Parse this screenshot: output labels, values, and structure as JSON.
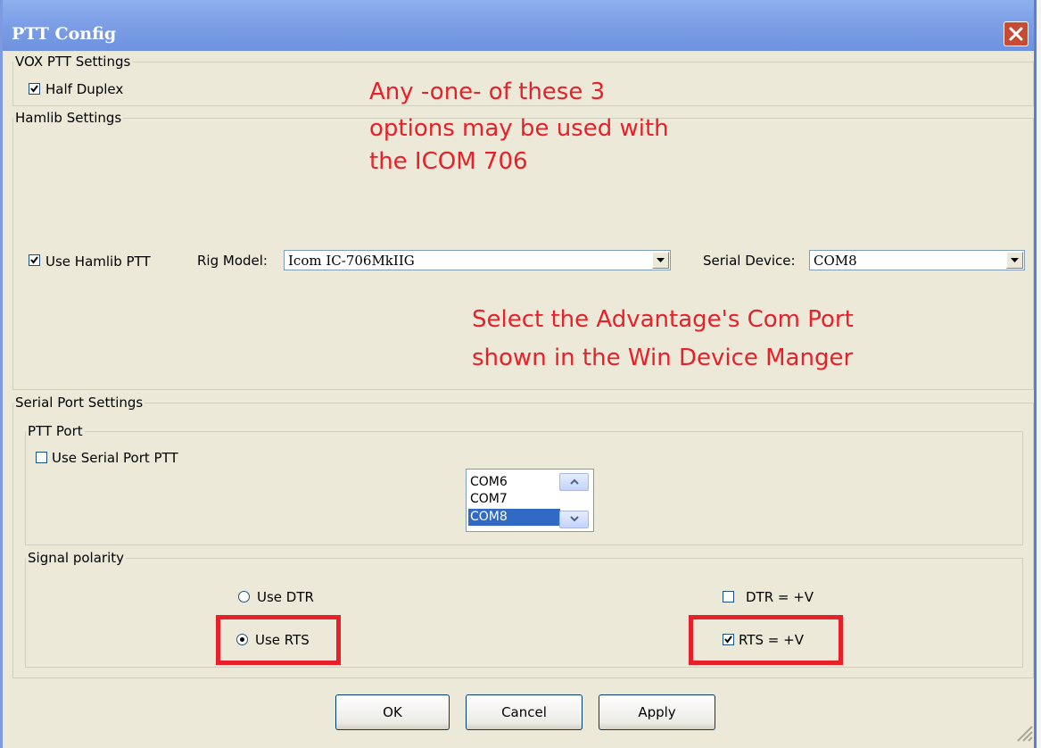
{
  "window": {
    "title": "PTT Config"
  },
  "vox": {
    "legend": "VOX PTT Settings",
    "half_duplex_label": "Half Duplex",
    "half_duplex_checked": true
  },
  "hamlib": {
    "legend": "Hamlib Settings",
    "use_hamlib_label": "Use Hamlib PTT",
    "use_hamlib_checked": true,
    "rig_model_label": "Rig Model:",
    "rig_model_value": "Icom IC-706MkIIG",
    "serial_device_label": "Serial Device:",
    "serial_device_value": "COM8"
  },
  "annotations": {
    "options_note": [
      "Any -one- of these 3",
      "options may be used with",
      "the ICOM 706"
    ],
    "com_port_note": [
      "Select the Advantage's Com Port",
      "shown in the Win Device Manger"
    ],
    "color": "#e8202a"
  },
  "serial": {
    "legend": "Serial Port Settings",
    "ptt_port_legend": "PTT Port",
    "use_serial_label": "Use Serial Port PTT",
    "use_serial_checked": false,
    "ports": [
      "COM6",
      "COM7",
      "COM8"
    ],
    "selected_port": "COM8"
  },
  "polarity": {
    "legend": "Signal polarity",
    "use_dtr_label": "Use DTR",
    "use_rts_label": "Use RTS",
    "selected": "Use RTS",
    "dtr_label": "DTR = +V",
    "dtr_checked": false,
    "rts_label": "RTS = +V",
    "rts_checked": true
  },
  "buttons": {
    "ok": "OK",
    "cancel": "Cancel",
    "apply": "Apply"
  },
  "icons": {
    "close": "close-icon",
    "check": "checkmark-icon",
    "dropdown": "chevron-down-icon",
    "scroll_up": "chevron-up-icon",
    "scroll_down": "chevron-down-icon",
    "resize": "resize-grip-icon"
  },
  "colors": {
    "titlebar": "#7d9fe6",
    "close": "#c84a34",
    "selection": "#316ac5",
    "dialog": "#ece9d8"
  }
}
